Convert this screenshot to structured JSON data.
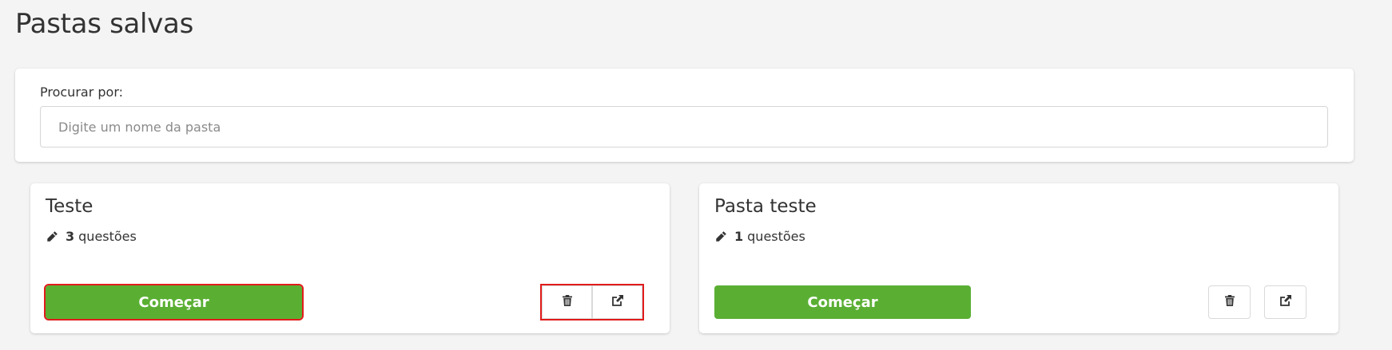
{
  "page": {
    "title": "Pastas salvas"
  },
  "search": {
    "label": "Procurar por:",
    "placeholder": "Digite um nome da pasta",
    "value": ""
  },
  "folders": [
    {
      "name": "Teste",
      "count": "3",
      "count_label": "questões",
      "start_label": "Começar",
      "highlighted": true
    },
    {
      "name": "Pasta teste",
      "count": "1",
      "count_label": "questões",
      "start_label": "Começar",
      "highlighted": false
    }
  ],
  "icons": {
    "count": "pencil-icon",
    "delete": "trash-icon",
    "open": "external-link-icon"
  },
  "colors": {
    "background": "#f4f4f4",
    "card": "#ffffff",
    "primary_button": "#5aaf33",
    "highlight_outline": "#e11b1b",
    "text": "#333333"
  }
}
